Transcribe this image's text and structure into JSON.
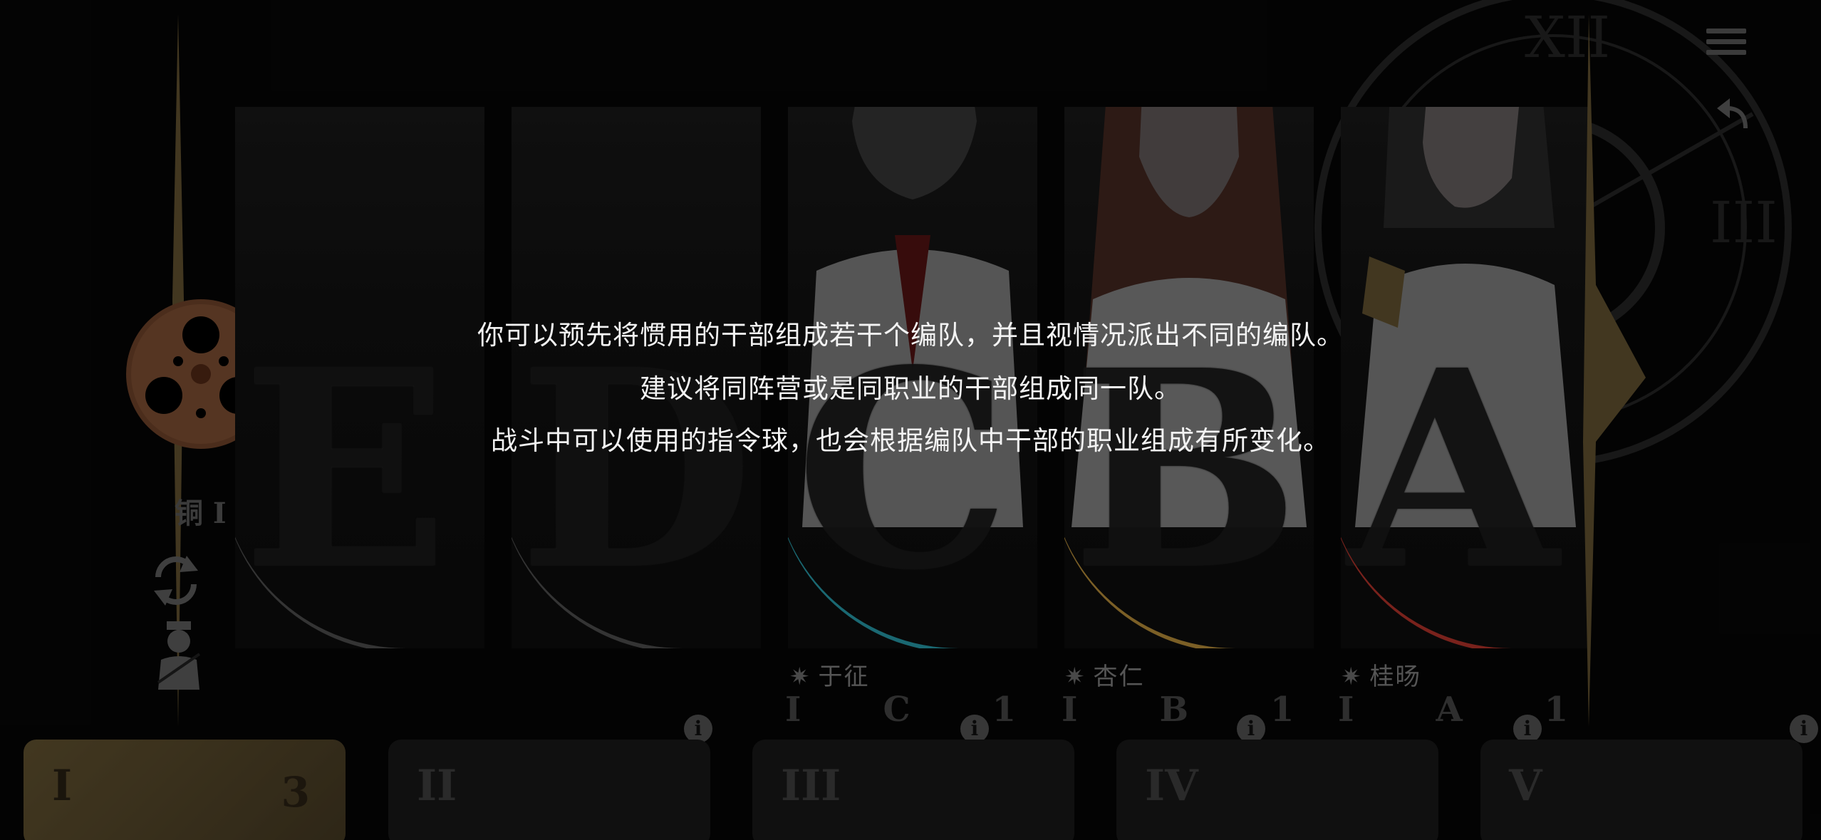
{
  "hint": {
    "lines": [
      "你可以预先将惯用的干部组成若干个编队，并且视情况派出不同的编队。",
      "建议将同阵营或是同职业的干部组成同一队。",
      "战斗中可以使用的指令球，也会根据编队中干部的职业组成有所变化。"
    ]
  },
  "left_panel": {
    "rank_label": "铜 I",
    "refresh_icon": "refresh-icon",
    "auto_icon": "auto-soldier-icon",
    "emblem_icon": "film-reel-emblem-icon"
  },
  "slots": [
    {
      "letter": "E",
      "info": "i",
      "empty": true
    },
    {
      "letter": "D",
      "info": "i",
      "empty": true
    },
    {
      "letter": "C",
      "info": "i",
      "empty": false,
      "name": "于征",
      "stats": [
        "I",
        "C",
        "1"
      ],
      "ring": "#2aa9b8"
    },
    {
      "letter": "B",
      "info": "i",
      "empty": false,
      "name": "杏仁",
      "stats": [
        "I",
        "B",
        "1"
      ],
      "ring": "#c79a3e"
    },
    {
      "letter": "A",
      "info": "i",
      "empty": false,
      "name": "桂旸",
      "stats": [
        "I",
        "A",
        "1"
      ],
      "ring": "#c4382e"
    }
  ],
  "team_tabs": [
    {
      "label": "I",
      "count": "3",
      "active": true
    },
    {
      "label": "II",
      "count": "",
      "active": false
    },
    {
      "label": "III",
      "count": "",
      "active": false
    },
    {
      "label": "IV",
      "count": "",
      "active": false
    },
    {
      "label": "V",
      "count": "",
      "active": false
    }
  ],
  "top_right": {
    "menu_icon": "hamburger-menu-icon",
    "back_icon": "back-arrow-icon"
  },
  "colors": {
    "active_tab": "#6b5a34",
    "gold_accent": "#c9a85a"
  }
}
